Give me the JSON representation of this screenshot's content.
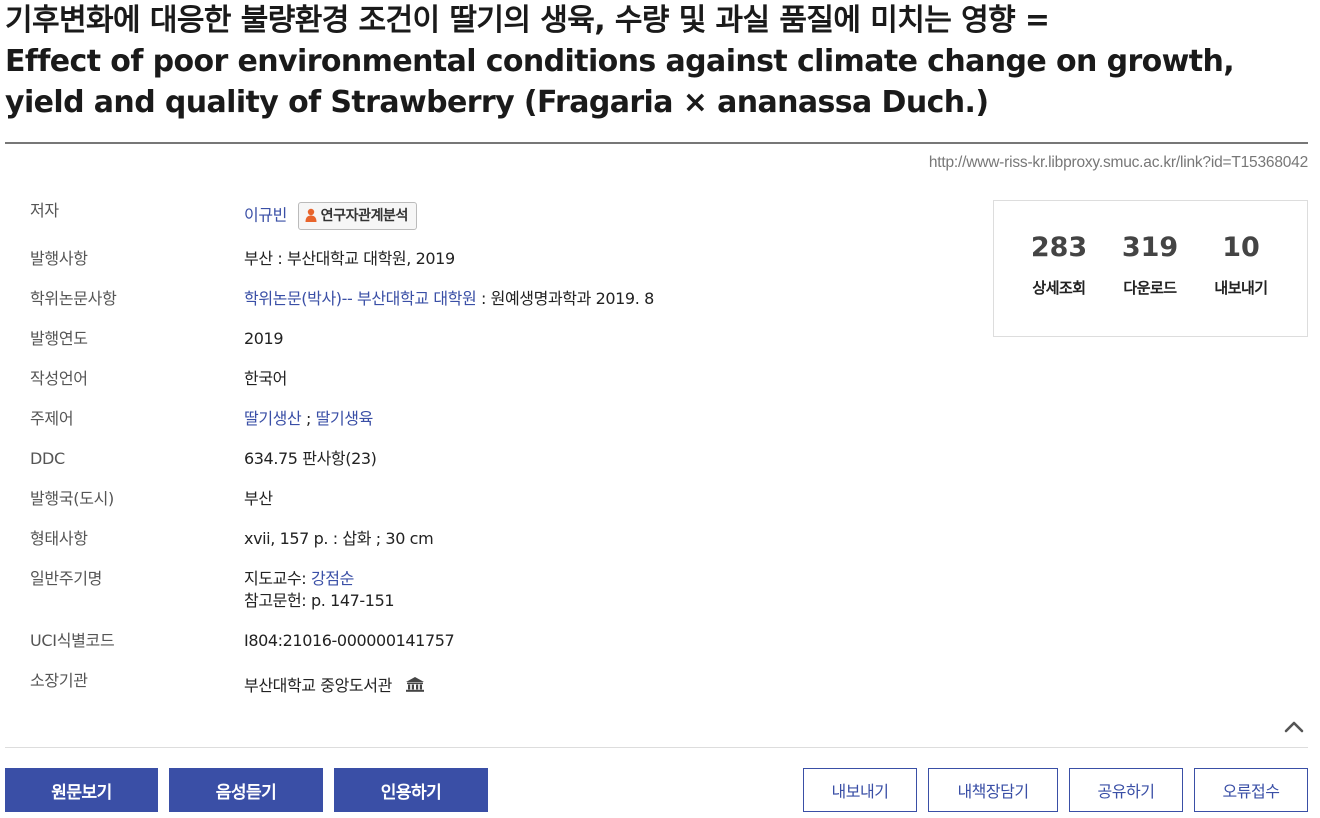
{
  "title": {
    "line1": "기후변화에 대응한 불량환경 조건이 딸기의 생육, 수량 및 과실 품질에 미치는 영향 =",
    "line2": "Effect of poor environmental conditions against climate change on growth,",
    "line3": "yield and quality of Strawberry (Fragaria × ananassa Duch.)"
  },
  "url": "http://www-riss-kr.libproxy.smuc.ac.kr/link?id=T15368042",
  "meta": {
    "author": {
      "label": "저자",
      "name": "이규빈",
      "badge": "연구자관계분석"
    },
    "publication": {
      "label": "발행사항",
      "value": "부산 : 부산대학교 대학원, 2019"
    },
    "degree": {
      "label": "학위논문사항",
      "link": "학위논문(박사)-- 부산대학교 대학원",
      "rest": " : 원예생명과학과 2019. 8"
    },
    "year": {
      "label": "발행연도",
      "value": "2019"
    },
    "language": {
      "label": "작성언어",
      "value": "한국어"
    },
    "subject": {
      "label": "주제어",
      "kw1": "딸기생산",
      "sep": " ; ",
      "kw2": "딸기생육"
    },
    "ddc": {
      "label": "DDC",
      "value": "634.75 판사항(23)"
    },
    "country": {
      "label": "발행국(도시)",
      "value": "부산"
    },
    "form": {
      "label": "형태사항",
      "value": "xvii, 157 p. : 삽화 ; 30 cm"
    },
    "note": {
      "label": "일반주기명",
      "advisor_prefix": "지도교수: ",
      "advisor": "강점순",
      "refs": "참고문헌: p. 147-151"
    },
    "uci": {
      "label": "UCI식별코드",
      "value": "I804:21016-000000141757"
    },
    "holding": {
      "label": "소장기관",
      "value": "부산대학교 중앙도서관"
    }
  },
  "stats": [
    {
      "value": "283",
      "label": "상세조회"
    },
    {
      "value": "319",
      "label": "다운로드"
    },
    {
      "value": "10",
      "label": "내보내기"
    }
  ],
  "buttons": {
    "view_original": "원문보기",
    "listen": "음성듣기",
    "cite": "인용하기",
    "export": "내보내기",
    "bookshelf": "내책장담기",
    "share": "공유하기",
    "report": "오류접수"
  },
  "colors": {
    "primary": "#3a4fa6",
    "link": "#3a4fa6",
    "badge_icon": "#e8642c"
  },
  "icons": {
    "researcher": "person-icon",
    "library": "library-building-icon",
    "collapse": "chevron-up-icon"
  }
}
